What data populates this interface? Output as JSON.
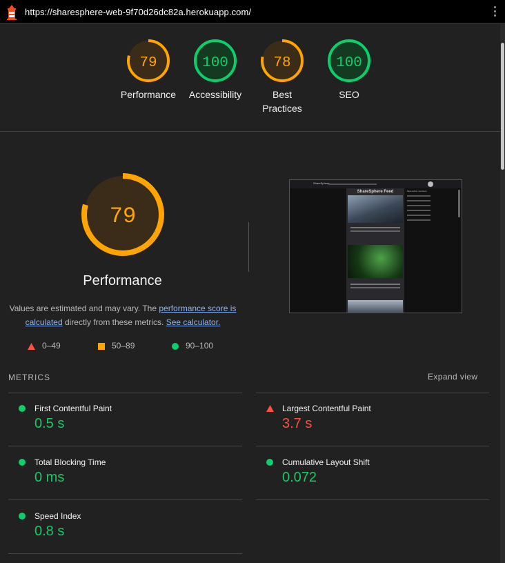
{
  "browser": {
    "url": "https://sharesphere-web-9f70d26dc82a.herokuapp.com/"
  },
  "summary": [
    {
      "score": "79",
      "label": "Performance",
      "value": 79,
      "status": "average"
    },
    {
      "score": "100",
      "label": "Accessibility",
      "value": 100,
      "status": "pass"
    },
    {
      "score": "78",
      "label": "Best Practices",
      "value": 78,
      "status": "average"
    },
    {
      "score": "100",
      "label": "SEO",
      "value": 100,
      "status": "pass"
    }
  ],
  "performance": {
    "score": "79",
    "value": 79,
    "title": "Performance",
    "note_prefix": "Values are estimated and may vary. The ",
    "score_link": "performance score is calculated",
    "note_middle": " directly from these metrics. ",
    "calc_link": "See calculator."
  },
  "legend": [
    {
      "range": "0–49",
      "shape": "triangle",
      "color": "#ff4e42"
    },
    {
      "range": "50–89",
      "shape": "square",
      "color": "#ffa400"
    },
    {
      "range": "90–100",
      "shape": "circle",
      "color": "#0cce6b"
    }
  ],
  "metrics": {
    "heading": "METRICS",
    "expand": "Expand view",
    "items": [
      {
        "name": "First Contentful Paint",
        "value": "0.5 s",
        "status": "pass"
      },
      {
        "name": "Largest Contentful Paint",
        "value": "3.7 s",
        "status": "fail"
      },
      {
        "name": "Total Blocking Time",
        "value": "0 ms",
        "status": "pass"
      },
      {
        "name": "Cumulative Layout Shift",
        "value": "0.072",
        "status": "pass"
      },
      {
        "name": "Speed Index",
        "value": "0.8 s",
        "status": "pass"
      }
    ]
  },
  "thumbnail": {
    "app_title": "ShareSphere Feed",
    "brand": "ShareSphere",
    "sidebar_title": "Most active members"
  },
  "colors": {
    "pass": "#0cce6b",
    "average": "#ffa400",
    "fail": "#ff4e42",
    "background": "#212121"
  }
}
